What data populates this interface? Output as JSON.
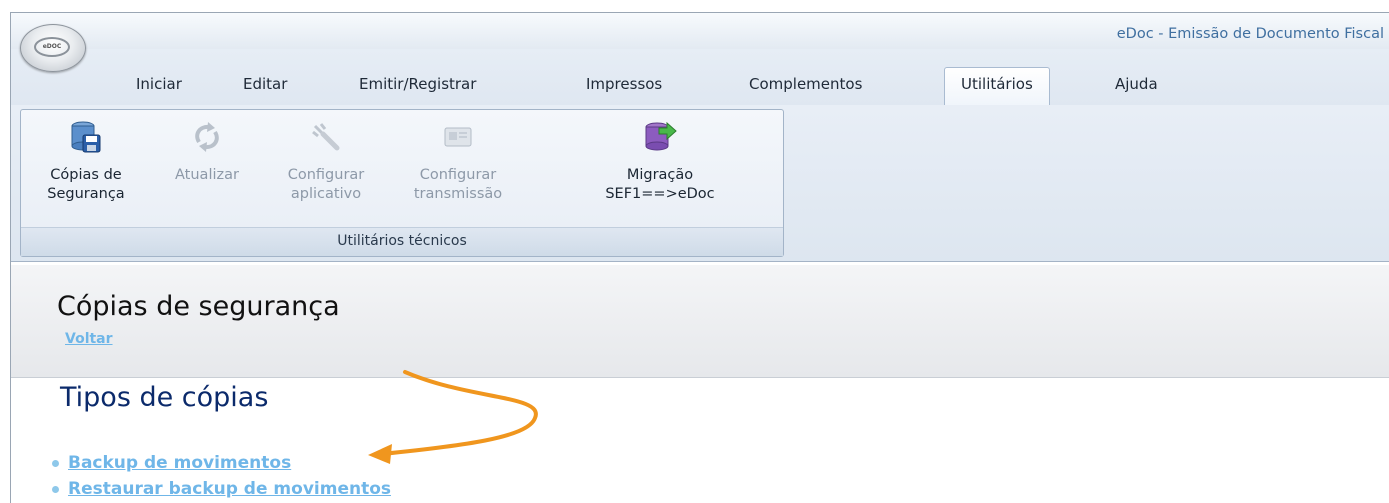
{
  "window": {
    "title": "eDoc - Emissão de Documento Fiscal"
  },
  "app_button": {
    "label": "eDOC"
  },
  "tabs": [
    {
      "label": "Iniciar"
    },
    {
      "label": "Editar"
    },
    {
      "label": "Emitir/Registrar"
    },
    {
      "label": "Impressos"
    },
    {
      "label": "Complementos"
    },
    {
      "label": "Utilitários",
      "active": true
    },
    {
      "label": "Ajuda"
    }
  ],
  "ribbon": {
    "group_label": "Utilitários técnicos",
    "buttons": [
      {
        "line1": "Cópias de",
        "line2": "Segurança",
        "icon": "database-save-icon",
        "enabled": true
      },
      {
        "line1": "Atualizar",
        "line2": "",
        "icon": "refresh-icon",
        "enabled": false
      },
      {
        "line1": "Configurar",
        "line2": "aplicativo",
        "icon": "wrench-icon",
        "enabled": false
      },
      {
        "line1": "Configurar",
        "line2": "transmissão",
        "icon": "transmission-card-icon",
        "enabled": false
      },
      {
        "line1": "Migração",
        "line2": "SEF1==>eDoc",
        "icon": "database-migrate-icon",
        "enabled": true
      }
    ]
  },
  "page": {
    "title": "Cópias de segurança",
    "back_link": "Voltar"
  },
  "section": {
    "title": "Tipos de cópias",
    "links": [
      {
        "label": "Backup de movimentos"
      },
      {
        "label": "Restaurar backup de movimentos"
      }
    ]
  },
  "colors": {
    "link": "#6fb6e8",
    "section_title": "#0b2a6b",
    "annotation_arrow": "#f0961e",
    "title_text": "#3f6fa0"
  }
}
